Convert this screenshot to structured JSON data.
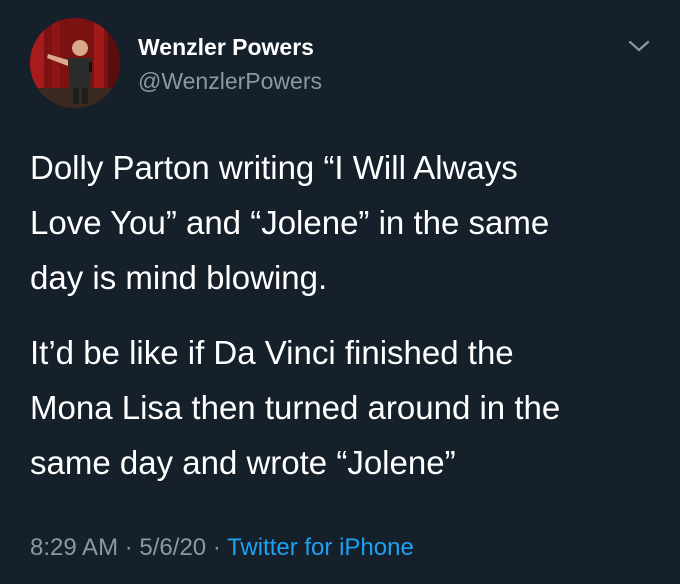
{
  "user": {
    "display_name": "Wenzler Powers",
    "handle": "@WenzlerPowers",
    "avatar_icon": "profile-photo"
  },
  "tweet": {
    "paragraphs": [
      "Dolly Parton writing “I Will Always\nLove You” and “Jolene” in the same\nday is mind blowing.",
      "It’d be like if Da Vinci finished the\nMona Lisa then turned around in the\nsame day and wrote “Jolene”"
    ],
    "time": "8:29 AM",
    "separator": "·",
    "date": "5/6/20",
    "source": "Twitter for iPhone"
  },
  "icons": {
    "more": "chevron-down-icon"
  },
  "colors": {
    "background": "#15202b",
    "text": "#ffffff",
    "secondary": "#8899a6",
    "link": "#1da1f2"
  }
}
